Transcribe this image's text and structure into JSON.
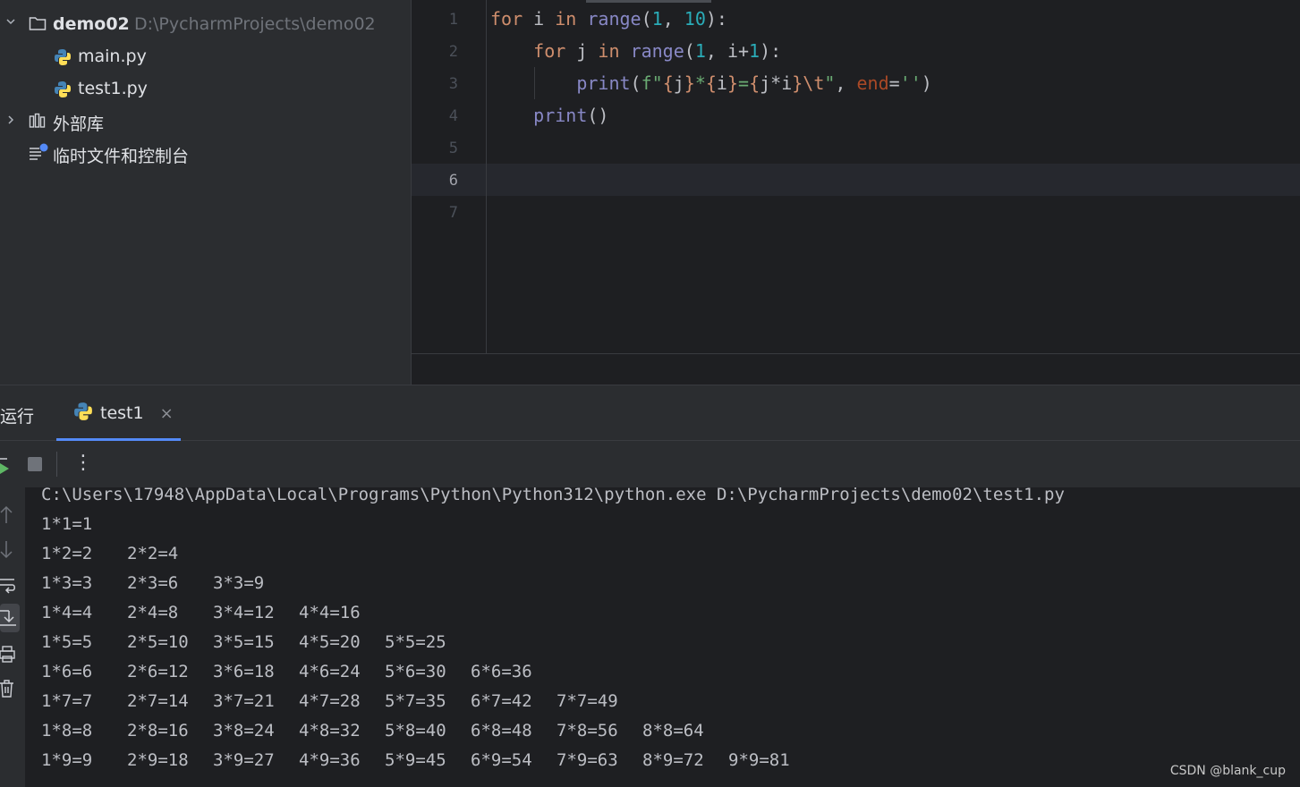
{
  "project": {
    "root_name": "demo02",
    "root_path": "D:\\PycharmProjects\\demo02",
    "files": [
      "main.py",
      "test1.py"
    ],
    "external_libs": "外部库",
    "scratches": "临时文件和控制台"
  },
  "editor": {
    "line_numbers": [
      "1",
      "2",
      "3",
      "4",
      "5",
      "6",
      "7"
    ],
    "current_line": "6"
  },
  "run": {
    "title": "运行",
    "tab_label": "test1",
    "close": "×",
    "more": "⋮"
  },
  "console": {
    "command": "C:\\Users\\17948\\AppData\\Local\\Programs\\Python\\Python312\\python.exe D:\\PycharmProjects\\demo02\\test1.py",
    "rows": [
      [
        "1*1=1"
      ],
      [
        "1*2=2",
        "2*2=4"
      ],
      [
        "1*3=3",
        "2*3=6",
        "3*3=9"
      ],
      [
        "1*4=4",
        "2*4=8",
        "3*4=12",
        "4*4=16"
      ],
      [
        "1*5=5",
        "2*5=10",
        "3*5=15",
        "4*5=20",
        "5*5=25"
      ],
      [
        "1*6=6",
        "2*6=12",
        "3*6=18",
        "4*6=24",
        "5*6=30",
        "6*6=36"
      ],
      [
        "1*7=7",
        "2*7=14",
        "3*7=21",
        "4*7=28",
        "5*7=35",
        "6*7=42",
        "7*7=49"
      ],
      [
        "1*8=8",
        "2*8=16",
        "3*8=24",
        "4*8=32",
        "5*8=40",
        "6*8=48",
        "7*8=56",
        "8*8=64"
      ],
      [
        "1*9=9",
        "2*9=18",
        "3*9=27",
        "4*9=36",
        "5*9=45",
        "6*9=54",
        "7*9=63",
        "8*9=72",
        "9*9=81"
      ]
    ]
  },
  "watermark": "CSDN @blank_cup"
}
